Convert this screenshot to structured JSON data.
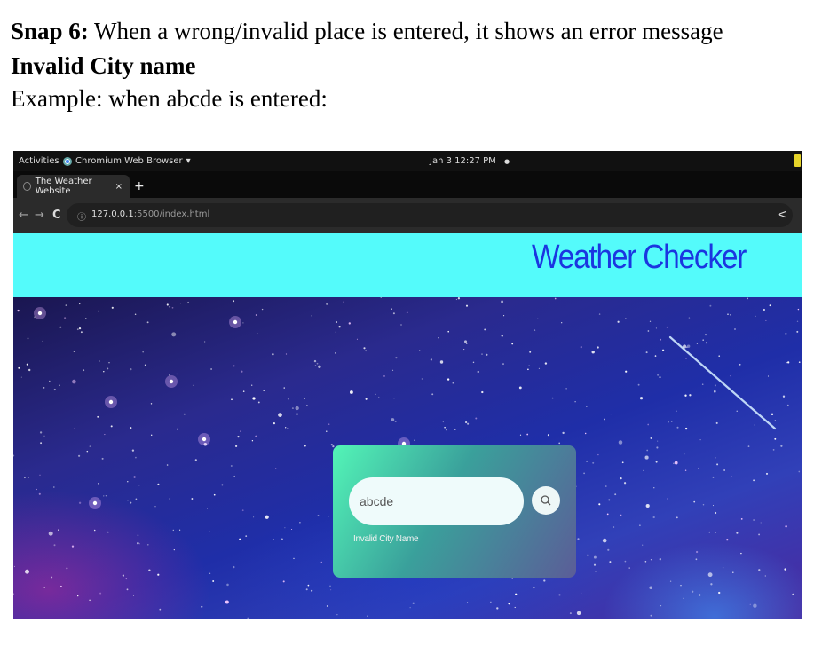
{
  "document": {
    "snap_label": "Snap 6:",
    "snap_text": " When a wrong/invalid place is entered, it shows an error message",
    "error_heading": "Invalid City name",
    "example_text": "Example: when abcde is entered:"
  },
  "system_bar": {
    "activities": "Activities",
    "app_menu": "Chromium Web Browser",
    "app_menu_caret": "▾",
    "clock": "Jan 3  12:27 PM",
    "clock_dot": "●"
  },
  "browser": {
    "tab_title": "The Weather Website",
    "tab_close": "×",
    "new_tab": "+",
    "back": "←",
    "forward": "→",
    "reload": "C",
    "info": "ⓘ",
    "url_host": "127.0.0.1",
    "url_path": ":5500/index.html",
    "share": "<"
  },
  "page": {
    "title": "Weather Checker",
    "search_value": "abcde",
    "error_message": "Invalid City Name",
    "search_icon": "search-icon"
  },
  "colors": {
    "header_band": "#54fbfb",
    "title": "#1b36e0",
    "card_start": "#53f5b7",
    "card_end": "#5b5d98"
  }
}
